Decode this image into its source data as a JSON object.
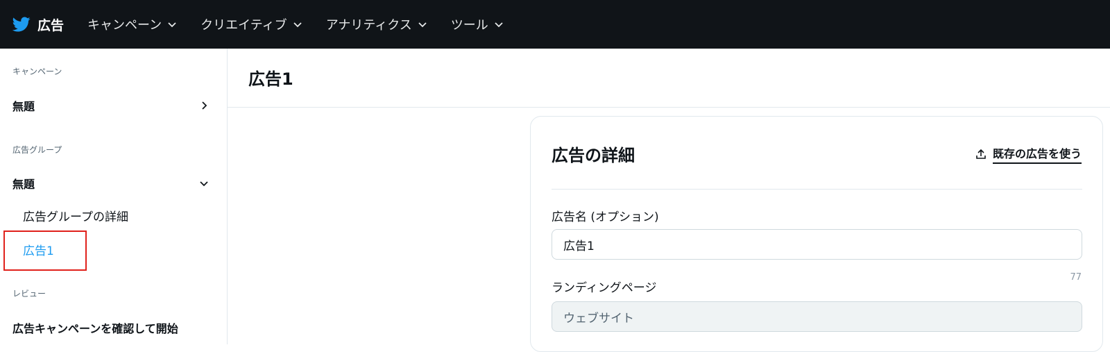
{
  "topbar": {
    "brand": "広告",
    "nav": [
      {
        "label": "キャンペーン"
      },
      {
        "label": "クリエイティブ"
      },
      {
        "label": "アナリティクス"
      },
      {
        "label": "ツール"
      }
    ]
  },
  "sidebar": {
    "campaign_section": "キャンペーン",
    "campaign_name": "無題",
    "adgroup_section": "広告グループ",
    "adgroup_name": "無題",
    "adgroup_details": "広告グループの詳細",
    "ad_item": "広告1",
    "review_section": "レビュー",
    "review_item": "広告キャンペーンを確認して開始"
  },
  "main": {
    "title": "広告1",
    "card": {
      "title": "広告の詳細",
      "use_existing": "既存の広告を使う",
      "ad_name_label": "広告名 (オプション)",
      "ad_name_value": "広告1",
      "char_count": "77",
      "landing_label": "ランディングページ",
      "landing_value": "ウェブサイト"
    }
  },
  "colors": {
    "topbar_bg": "#101418",
    "accent": "#1d9bf0",
    "highlight": "#e0211b"
  },
  "icons": [
    "twitter-bird-icon",
    "chevron-down-icon",
    "chevron-right-icon",
    "upload-icon"
  ]
}
